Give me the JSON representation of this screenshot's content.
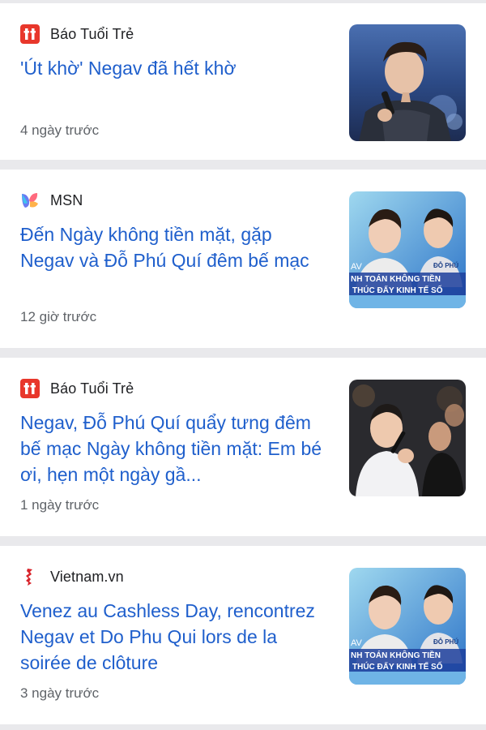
{
  "articles": [
    {
      "source": "Báo Tuổi Trẻ",
      "source_icon": "tuoitre-logo-icon",
      "headline": "'Út khờ' Negav đã hết khờ",
      "time": "4 ngày trước",
      "thumbnail": "concert-singer-thumbnail"
    },
    {
      "source": "MSN",
      "source_icon": "msn-logo-icon",
      "headline": "Đến Ngày không tiền mặt, gặp Negav và Đỗ Phú Quí đêm bế mạc",
      "time": "12 giờ trước",
      "thumbnail": "promo-poster-thumbnail",
      "thumbnail_text": [
        "AV",
        "ĐỖ PHÚ",
        "NH TOÁN KHÔNG TIỀN",
        "THÚC ĐẨY KINH TẾ SỐ"
      ]
    },
    {
      "source": "Báo Tuổi Trẻ",
      "source_icon": "tuoitre-logo-icon",
      "headline": "Negav, Đỗ Phú Quí quẩy tưng đêm bế mạc Ngày không tiền mặt: Em bé ơi, hẹn một ngày gầ...",
      "time": "1 ngày trước",
      "thumbnail": "stage-performance-thumbnail"
    },
    {
      "source": "Vietnam.vn",
      "source_icon": "vietnam-vn-logo-icon",
      "headline": "Venez au Cashless Day, rencontrez Negav et Do Phu Qui lors de la soirée de clôture",
      "time": "3 ngày trước",
      "thumbnail": "promo-poster-thumbnail",
      "thumbnail_text": [
        "AV",
        "ĐỖ PHÚ",
        "NH TOÁN KHÔNG TIỀN",
        "THÚC ĐẨY KINH TẾ SỐ"
      ]
    }
  ],
  "colors": {
    "headline": "#1f5fcc",
    "meta": "#5f6368",
    "source": "#202124",
    "separator": "#e9e9ec",
    "tuoitre_red": "#e8372b",
    "vietnam_red": "#d8232a"
  }
}
